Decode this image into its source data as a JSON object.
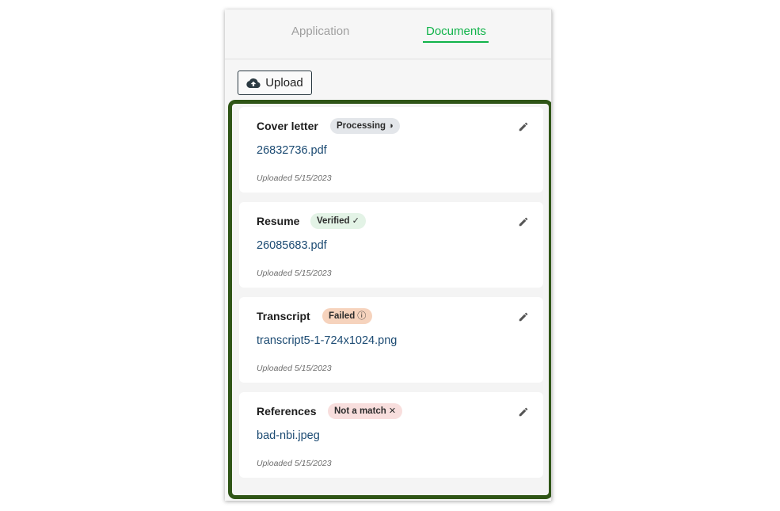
{
  "tabs": [
    {
      "label": "Application",
      "active": false
    },
    {
      "label": "Documents",
      "active": true
    }
  ],
  "upload": {
    "label": "Upload",
    "icon": "cloud-upload-icon"
  },
  "colors": {
    "accent": "#11b34a",
    "frame": "#2f5516",
    "link": "#1b4a72"
  },
  "documents": [
    {
      "title": "Cover letter",
      "status": "Processing",
      "status_icon": "◑",
      "status_icon_name": "half-circle-icon",
      "status_bg": "#e3e6ea",
      "file": "26832736.pdf",
      "uploaded": "Uploaded 5/15/2023"
    },
    {
      "title": "Resume",
      "status": "Verified",
      "status_icon": "✓",
      "status_icon_name": "check-icon",
      "status_bg": "#e3f3e6",
      "file": "26085683.pdf",
      "uploaded": "Uploaded 5/15/2023"
    },
    {
      "title": "Transcript",
      "status": "Failed",
      "status_icon": "ⓘ",
      "status_icon_name": "info-icon",
      "status_bg": "#f6d3bd",
      "file": "transcript5-1-724x1024.png",
      "uploaded": "Uploaded 5/15/2023"
    },
    {
      "title": "References",
      "status": "Not a match",
      "status_icon": "✕",
      "status_icon_name": "close-icon",
      "status_bg": "#f8dedd",
      "file": "bad-nbi.jpeg",
      "uploaded": "Uploaded 5/15/2023"
    }
  ]
}
